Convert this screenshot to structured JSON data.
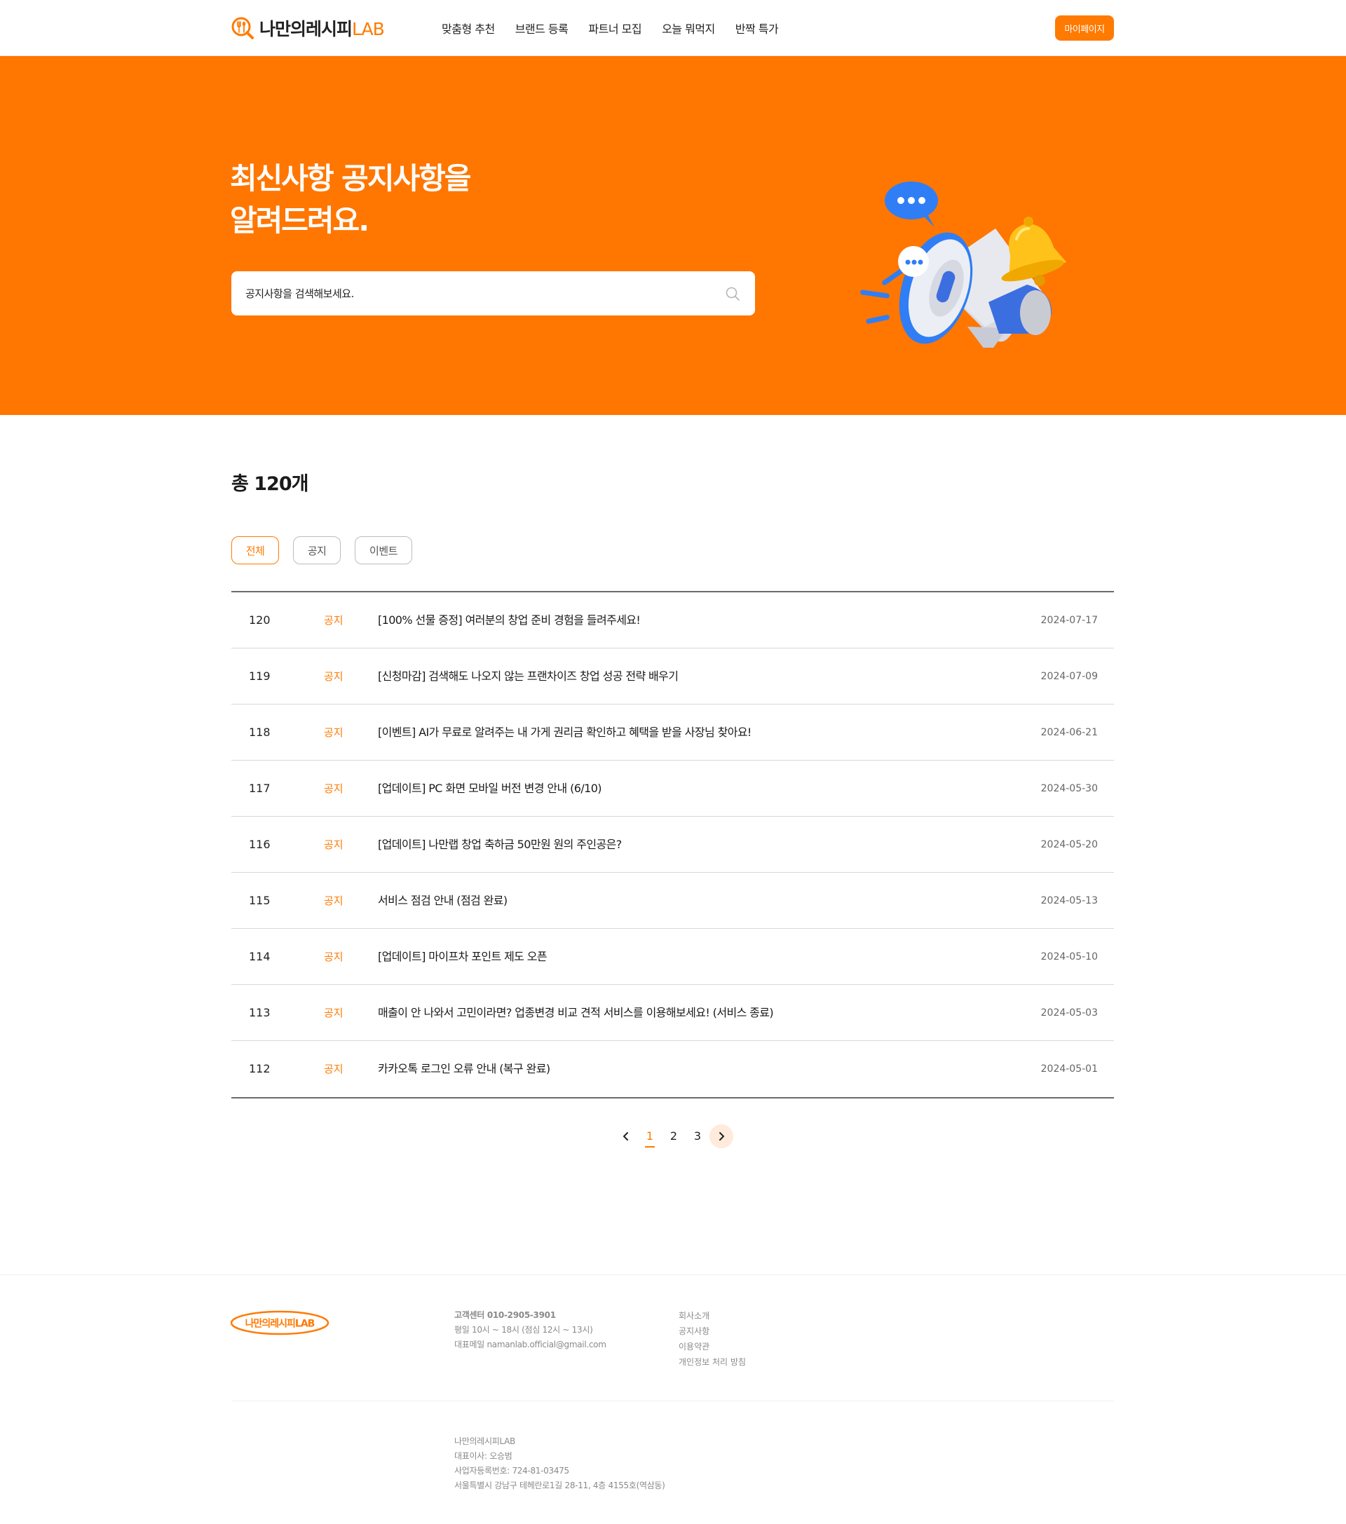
{
  "header": {
    "logo_main": "나만의레시피",
    "logo_accent": "LAB",
    "nav": [
      "맞춤형 추천",
      "브랜드 등록",
      "파트너 모집",
      "오늘 뭐먹지",
      "반짝 특가"
    ],
    "mypage_label": "마이페이지"
  },
  "hero": {
    "title_line1": "최신사항 공지사항을",
    "title_line2": "알려드려요.",
    "search_placeholder": "공지사항을 검색해보세요."
  },
  "content": {
    "total_label": "총 120개",
    "filters": [
      "전체",
      "공지",
      "이벤트"
    ],
    "rows": [
      {
        "num": "120",
        "category": "공지",
        "title": "[100% 선물 증정] 여러분의 창업 준비 경험을 들려주세요!",
        "date": "2024-07-17"
      },
      {
        "num": "119",
        "category": "공지",
        "title": "[신청마감] 검색해도 나오지 않는 프랜차이즈 창업 성공 전략 배우기",
        "date": "2024-07-09"
      },
      {
        "num": "118",
        "category": "공지",
        "title": "[이벤트] AI가 무료로 알려주는 내 가게 권리금 확인하고 혜택을 받을 사장님 찾아요!",
        "date": "2024-06-21"
      },
      {
        "num": "117",
        "category": "공지",
        "title": "[업데이트] PC 화면 모바일 버전 변경 안내 (6/10)",
        "date": "2024-05-30"
      },
      {
        "num": "116",
        "category": "공지",
        "title": "[업데이트] 나만랩 창업 축하금 50만원 원의 주인공은?",
        "date": "2024-05-20"
      },
      {
        "num": "115",
        "category": "공지",
        "title": "서비스 점검 안내 (점검 완료)",
        "date": "2024-05-13"
      },
      {
        "num": "114",
        "category": "공지",
        "title": "[업데이트] 마이프차 포인트 제도 오픈",
        "date": "2024-05-10"
      },
      {
        "num": "113",
        "category": "공지",
        "title": "매출이 안 나와서 고민이라면? 업종변경 비교 견적 서비스를 이용해보세요! (서비스 종료)",
        "date": "2024-05-03"
      },
      {
        "num": "112",
        "category": "공지",
        "title": "카카오톡 로그인 오류 안내 (복구 완료)",
        "date": "2024-05-01"
      }
    ],
    "pagination": {
      "pages": [
        "1",
        "2",
        "3"
      ],
      "current": "1"
    }
  },
  "footer": {
    "logo_text": "나만의레시피LAB",
    "contact": [
      "고객센터 010-2905-3901",
      "평일 10시 ~ 18시 (점심 12시 ~ 13시)",
      "대표메일 namanlab.official@gmail.com"
    ],
    "links": [
      "회사소개",
      "공지사항",
      "이용약관",
      "개인정보 처리 방침"
    ],
    "company": [
      "나만의레시피LAB",
      "대표이사: 오승범",
      "사업자등록번호: 724-81-03475",
      "서울특별시 강남구 테헤란로1길 28-11, 4층 4155호(역삼동)"
    ]
  },
  "colors": {
    "brand": "#ff7a00",
    "hero_bg": "#ff7600",
    "text": "#1a1a1a",
    "muted": "#8a8a8a"
  },
  "icons": {
    "logo": "fork-spoon-magnifier-icon",
    "search": "search-icon",
    "prev": "chevron-left-icon",
    "next": "chevron-right-icon",
    "hero": "megaphone-bell-illustration"
  }
}
